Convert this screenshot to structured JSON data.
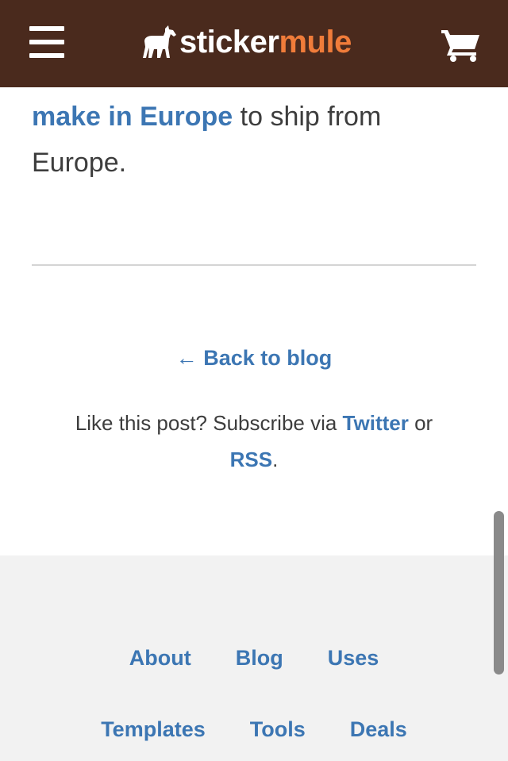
{
  "header": {
    "logo_word_1": "sticker",
    "logo_word_2": "mule",
    "colors": {
      "background": "#4a2a1d",
      "accent": "#f07c3a"
    }
  },
  "article": {
    "link_text": "make in Europe",
    "text_after_link": " to ship from",
    "text_line_2": "Europe."
  },
  "back_link": "← Back to blog",
  "subscribe": {
    "prefix": "Like this post? Subscribe via ",
    "twitter": "Twitter",
    "middle": " or ",
    "rss": "RSS",
    "suffix": "."
  },
  "footer": {
    "row1": [
      "About",
      "Blog",
      "Uses"
    ],
    "row2": [
      "Templates",
      "Tools",
      "Deals"
    ]
  },
  "colors": {
    "link": "#3c76b3",
    "text": "#3d3d3d",
    "footer_bg": "#f2f2f2"
  }
}
